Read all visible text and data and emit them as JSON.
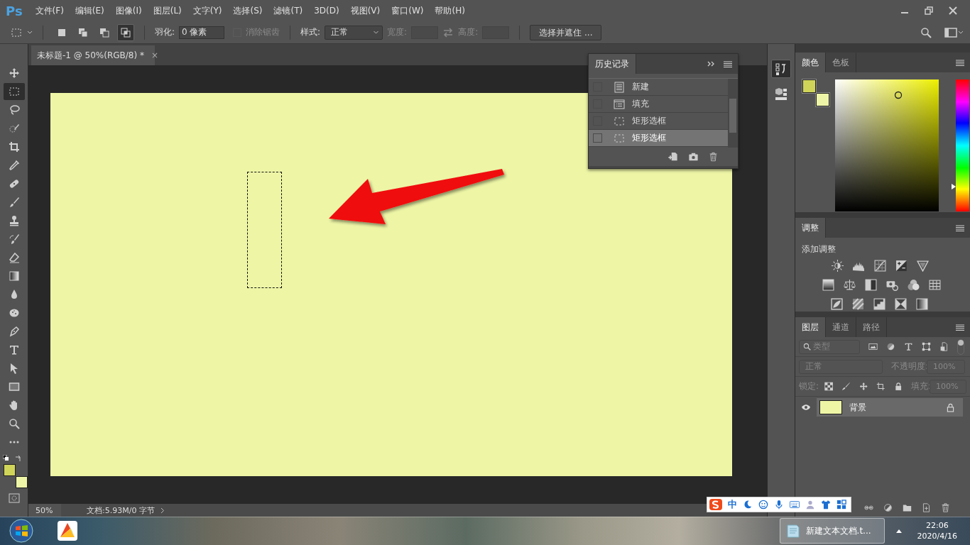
{
  "app": {
    "logo": "Ps"
  },
  "menu": [
    "文件(F)",
    "编辑(E)",
    "图像(I)",
    "图层(L)",
    "文字(Y)",
    "选择(S)",
    "滤镜(T)",
    "3D(D)",
    "视图(V)",
    "窗口(W)",
    "帮助(H)"
  ],
  "options_bar": {
    "selection_modes": [
      {
        "kind": "new",
        "selected": false
      },
      {
        "kind": "add",
        "selected": false
      },
      {
        "kind": "subtract",
        "selected": false
      },
      {
        "kind": "intersect",
        "selected": true
      }
    ],
    "feather_label": "羽化:",
    "feather_value": "0 像素",
    "antialias": {
      "label": "消除锯齿",
      "checked": false,
      "disabled": true
    },
    "style_label": "样式:",
    "style_value": "正常",
    "width_label": "宽度:",
    "height_label": "高度:",
    "mask_button": "选择并遮住 ..."
  },
  "tools": [
    {
      "kind": "move",
      "selected": false
    },
    {
      "kind": "marquee",
      "selected": true
    },
    {
      "kind": "lasso",
      "selected": false
    },
    {
      "kind": "quick",
      "selected": false
    },
    {
      "kind": "crop",
      "selected": false
    },
    {
      "kind": "eyedropper",
      "selected": false
    },
    {
      "kind": "bandage",
      "selected": false
    },
    {
      "kind": "brush",
      "selected": false
    },
    {
      "kind": "stamp",
      "selected": false
    },
    {
      "kind": "historybrush",
      "selected": false
    },
    {
      "kind": "eraser",
      "selected": false
    },
    {
      "kind": "gradient",
      "selected": false
    },
    {
      "kind": "blur",
      "selected": false
    },
    {
      "kind": "sponge",
      "selected": false
    },
    {
      "kind": "pen",
      "selected": false
    },
    {
      "kind": "type",
      "selected": false
    },
    {
      "kind": "pathselect",
      "selected": false
    },
    {
      "kind": "rect",
      "selected": false
    },
    {
      "kind": "hand",
      "selected": false
    },
    {
      "kind": "zoom",
      "selected": false
    },
    {
      "kind": "more",
      "selected": false
    }
  ],
  "tool_swatches": [
    {
      "kind": "foreground",
      "color": "#d0d55a"
    },
    {
      "kind": "background",
      "color": "#eef5a6"
    }
  ],
  "document_tab": {
    "title": "未标题-1 @ 50%(RGB/8) *",
    "close": "×"
  },
  "history_panel": {
    "title": "历史记录",
    "items": [
      {
        "kind": "document",
        "label": "新建",
        "selected": false
      },
      {
        "kind": "fill",
        "label": "填充",
        "selected": false
      },
      {
        "kind": "marquee",
        "label": "矩形选框",
        "selected": false
      },
      {
        "kind": "marquee",
        "label": "矩形选框",
        "selected": true
      }
    ]
  },
  "color_panel": {
    "tabs": [
      {
        "label": "颜色",
        "selected": true
      },
      {
        "label": "色板",
        "selected": false
      }
    ],
    "hue_slider": {
      "level": 0.19
    },
    "swatches": [
      {
        "kind": "foreground",
        "color": "#d0d55a"
      },
      {
        "kind": "background",
        "color": "#eef5a6"
      }
    ]
  },
  "adjustments_panel": {
    "tabs": [
      {
        "label": "调整",
        "selected": true
      }
    ],
    "heading": "添加调整"
  },
  "layers_panel": {
    "tabs": [
      {
        "label": "图层",
        "selected": true
      },
      {
        "label": "通道",
        "selected": false
      },
      {
        "label": "路径",
        "selected": false
      }
    ],
    "filter_placeholder": "类型",
    "blend_mode": "正常",
    "opacity_label": "不透明度:",
    "opacity_value": "100%",
    "lock_label": "锁定:",
    "fill_label": "填充:",
    "fill_value": "100%",
    "layers": [
      {
        "name": "背景",
        "visible": true,
        "selected": true,
        "locked": true
      }
    ]
  },
  "status_bar": {
    "zoom": "50%",
    "doc_info": "文档:5.93M/0 字节"
  },
  "ime_bar": {
    "mode": "中"
  },
  "taskbar": {
    "task": "新建文本文档.t...",
    "time": "22:06",
    "date": "2020/4/16"
  }
}
